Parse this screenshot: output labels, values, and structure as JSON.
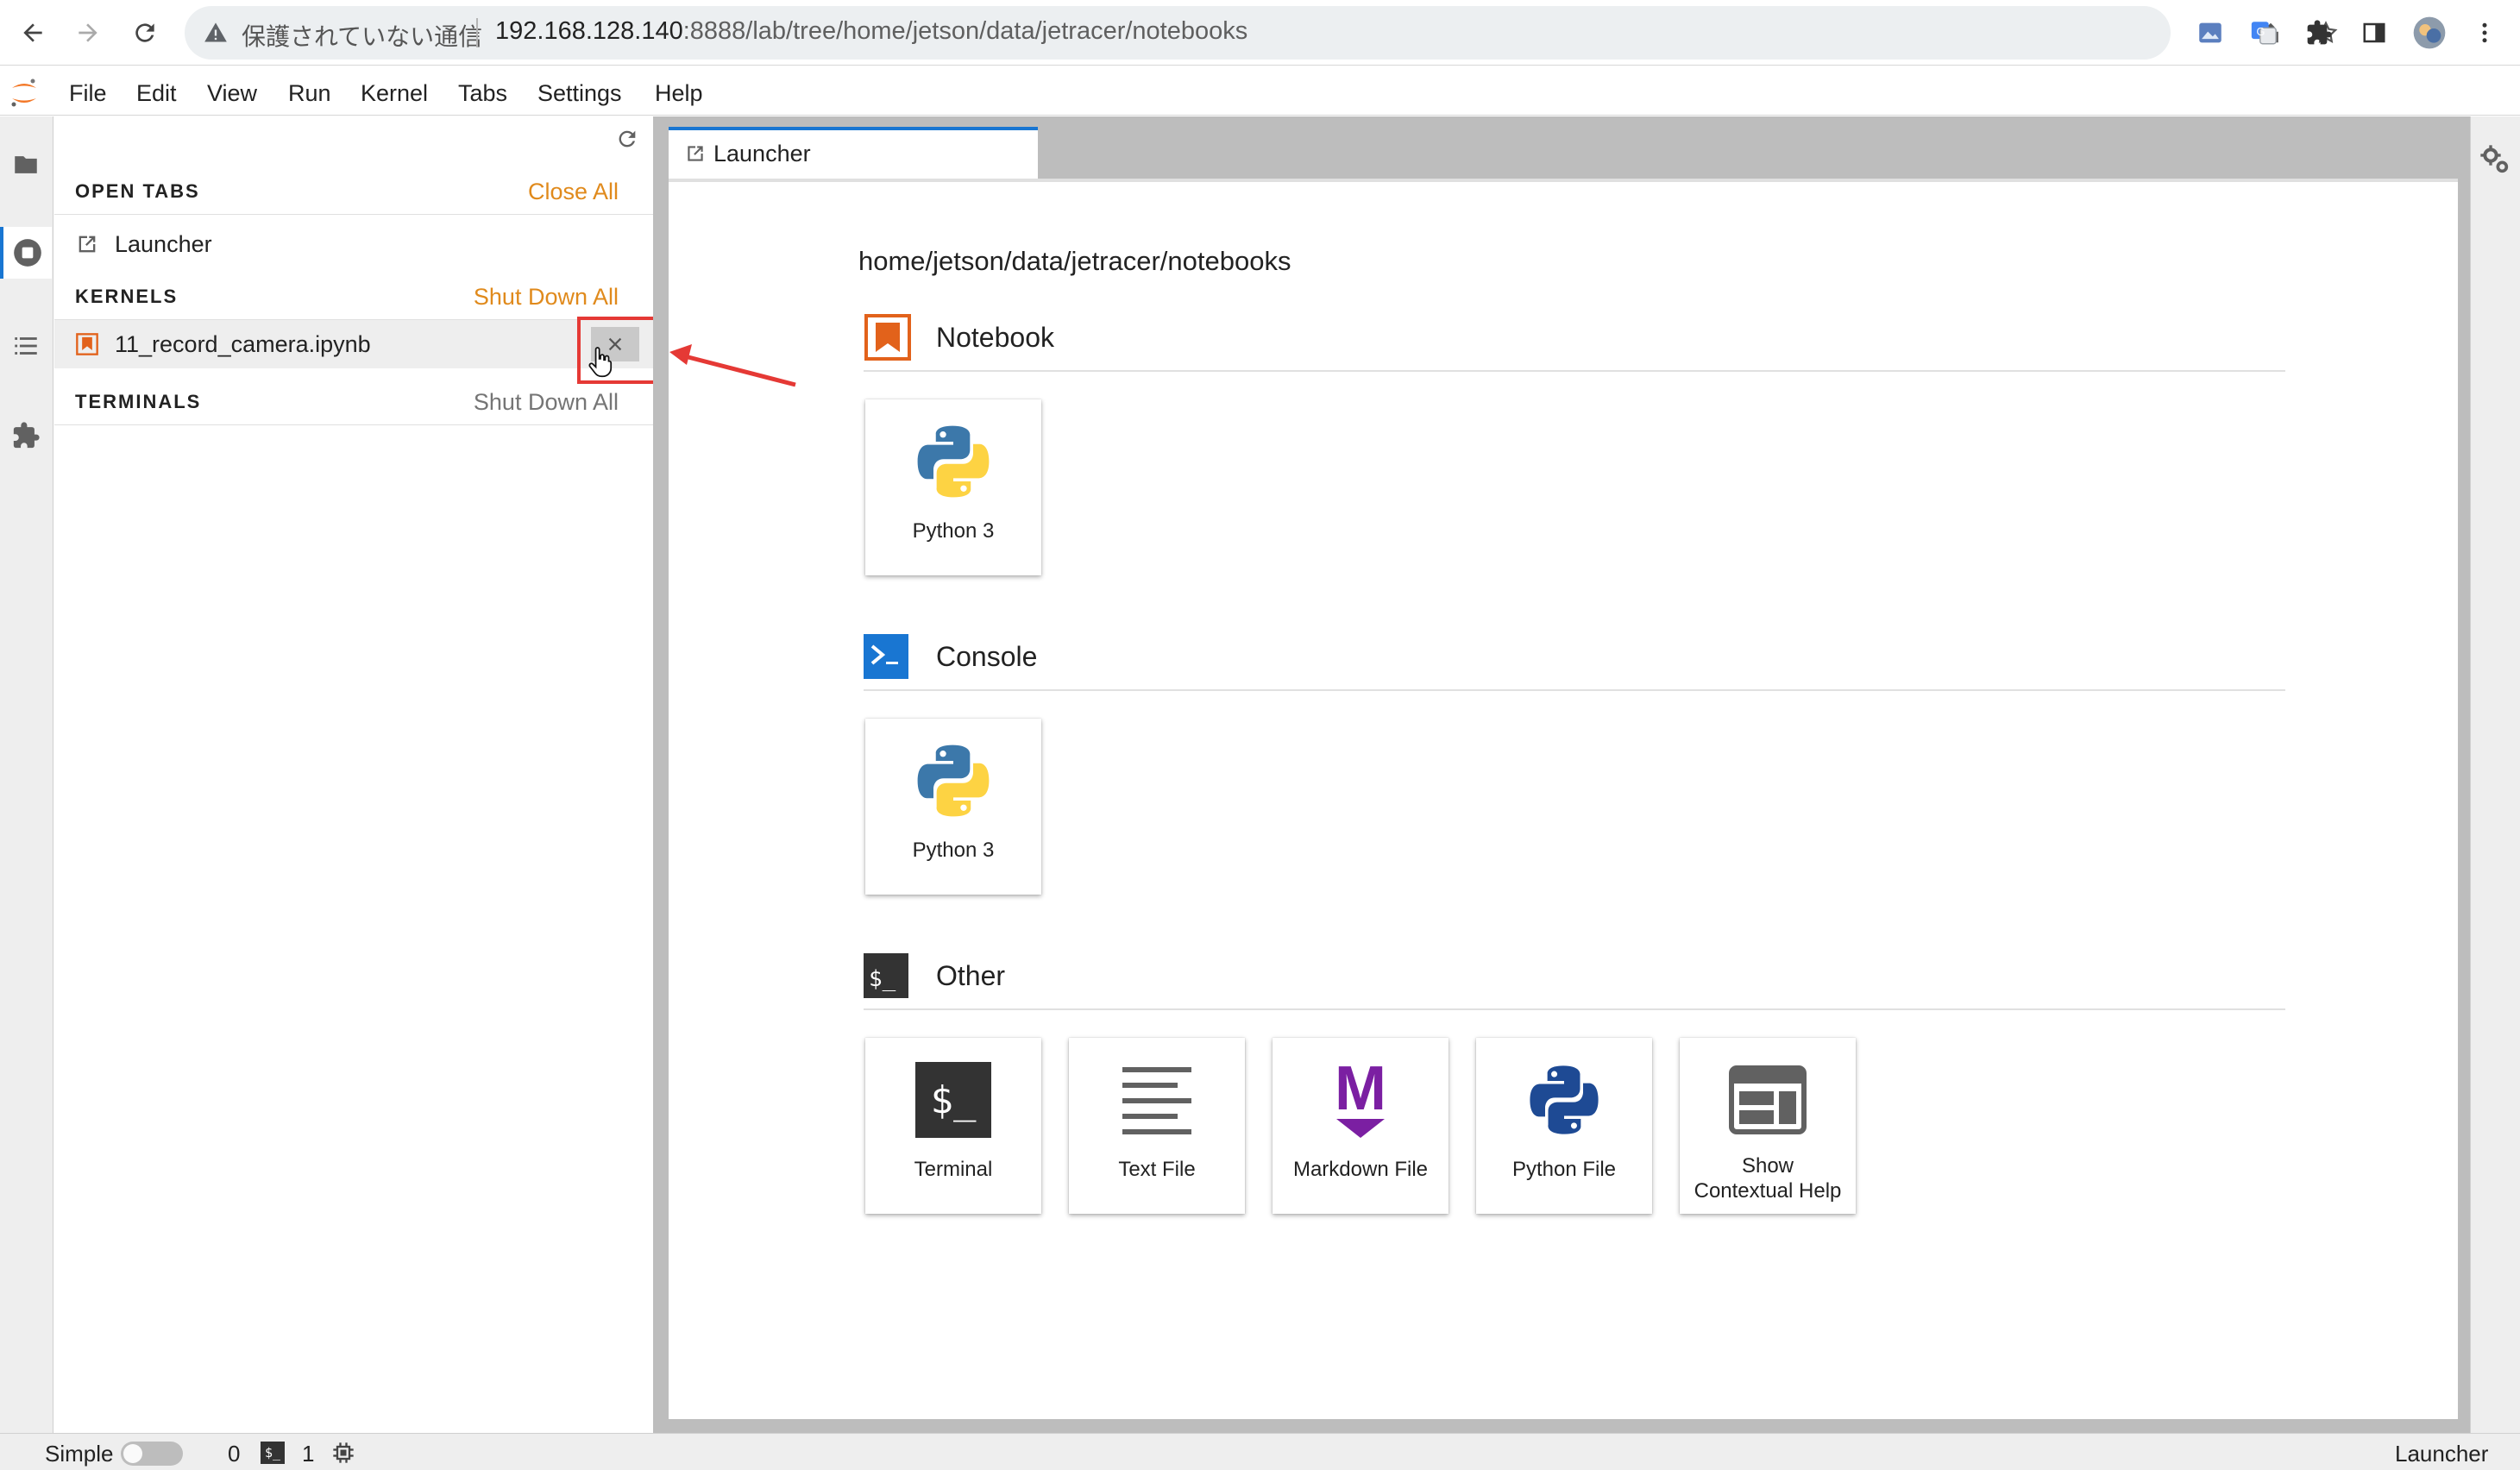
{
  "browser": {
    "insecure_label": "保護されていない通信",
    "url_host": "192.168.128.140",
    "url_rest": ":8888/lab/tree/home/jetson/data/jetracer/notebooks"
  },
  "menubar": {
    "items": [
      "File",
      "Edit",
      "View",
      "Run",
      "Kernel",
      "Tabs",
      "Settings",
      "Help"
    ]
  },
  "running": {
    "open_tabs": {
      "title": "OPEN TABS",
      "action": "Close All",
      "items": [
        "Launcher"
      ]
    },
    "kernels": {
      "title": "KERNELS",
      "action": "Shut Down All",
      "items": [
        "11_record_camera.ipynb"
      ]
    },
    "terminals": {
      "title": "TERMINALS",
      "action": "Shut Down All"
    }
  },
  "dock": {
    "tab_label": "Launcher"
  },
  "launcher": {
    "cwd": "home/jetson/data/jetracer/notebooks",
    "sections": {
      "notebook": {
        "title": "Notebook",
        "cards": [
          "Python 3"
        ]
      },
      "console": {
        "title": "Console",
        "cards": [
          "Python 3"
        ]
      },
      "other": {
        "title": "Other",
        "cards": [
          "Terminal",
          "Text File",
          "Markdown File",
          "Python File",
          "Show\nContextual Help"
        ]
      }
    },
    "other_icons": {
      "terminal_glyph": "$_",
      "markdown_glyph": "M"
    }
  },
  "statusbar": {
    "mode_label": "Simple",
    "kernel_count": "0",
    "terminal_count": "1",
    "terminal_glyph": "$_",
    "right_label": "Launcher"
  },
  "colors": {
    "accent": "#1976d2",
    "action_orange": "#e08a1c",
    "notebook_orange": "#e2621b",
    "console_blue": "#1976d2",
    "markdown_purple": "#7b1fa2",
    "highlight_red": "#e53935"
  }
}
